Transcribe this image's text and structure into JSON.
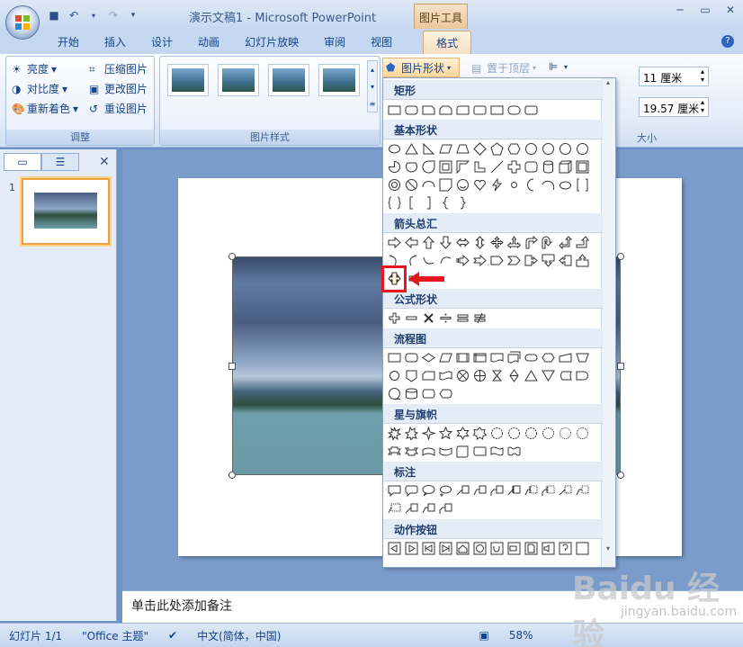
{
  "window": {
    "title": "演示文稿1 - Microsoft PowerPoint",
    "context_tab": "图片工具"
  },
  "tabs": [
    "开始",
    "插入",
    "设计",
    "动画",
    "幻灯片放映",
    "审阅",
    "视图",
    "格式"
  ],
  "ribbon": {
    "adjust": {
      "label": "调整",
      "brightness": "亮度",
      "contrast": "对比度",
      "recolor": "重新着色",
      "compress": "压缩图片",
      "change": "更改图片",
      "reset": "重设图片"
    },
    "styles": {
      "label": "图片样式"
    },
    "picture_shape": "图片形状",
    "bring_front": "置于顶层",
    "size": {
      "label": "大小",
      "height": "11 厘米",
      "width": "19.57 厘米"
    }
  },
  "left_pane": {
    "slide_number": "1"
  },
  "notes": {
    "placeholder": "单击此处添加备注"
  },
  "status": {
    "slide": "幻灯片 1/1",
    "theme": "\"Office 主题\"",
    "lang": "中文(简体，中国)",
    "zoom": "58%"
  },
  "dropdown": {
    "sections": [
      "矩形",
      "基本形状",
      "箭头总汇",
      "公式形状",
      "流程图",
      "星与旗帜",
      "标注",
      "动作按钮"
    ]
  },
  "watermark": {
    "brand": "Baidu 经验",
    "url": "jingyan.baidu.com"
  },
  "colors": {
    "ribbon_bg": "#e3ecf8",
    "highlight": "#e6171e",
    "accent": "#15428b"
  }
}
